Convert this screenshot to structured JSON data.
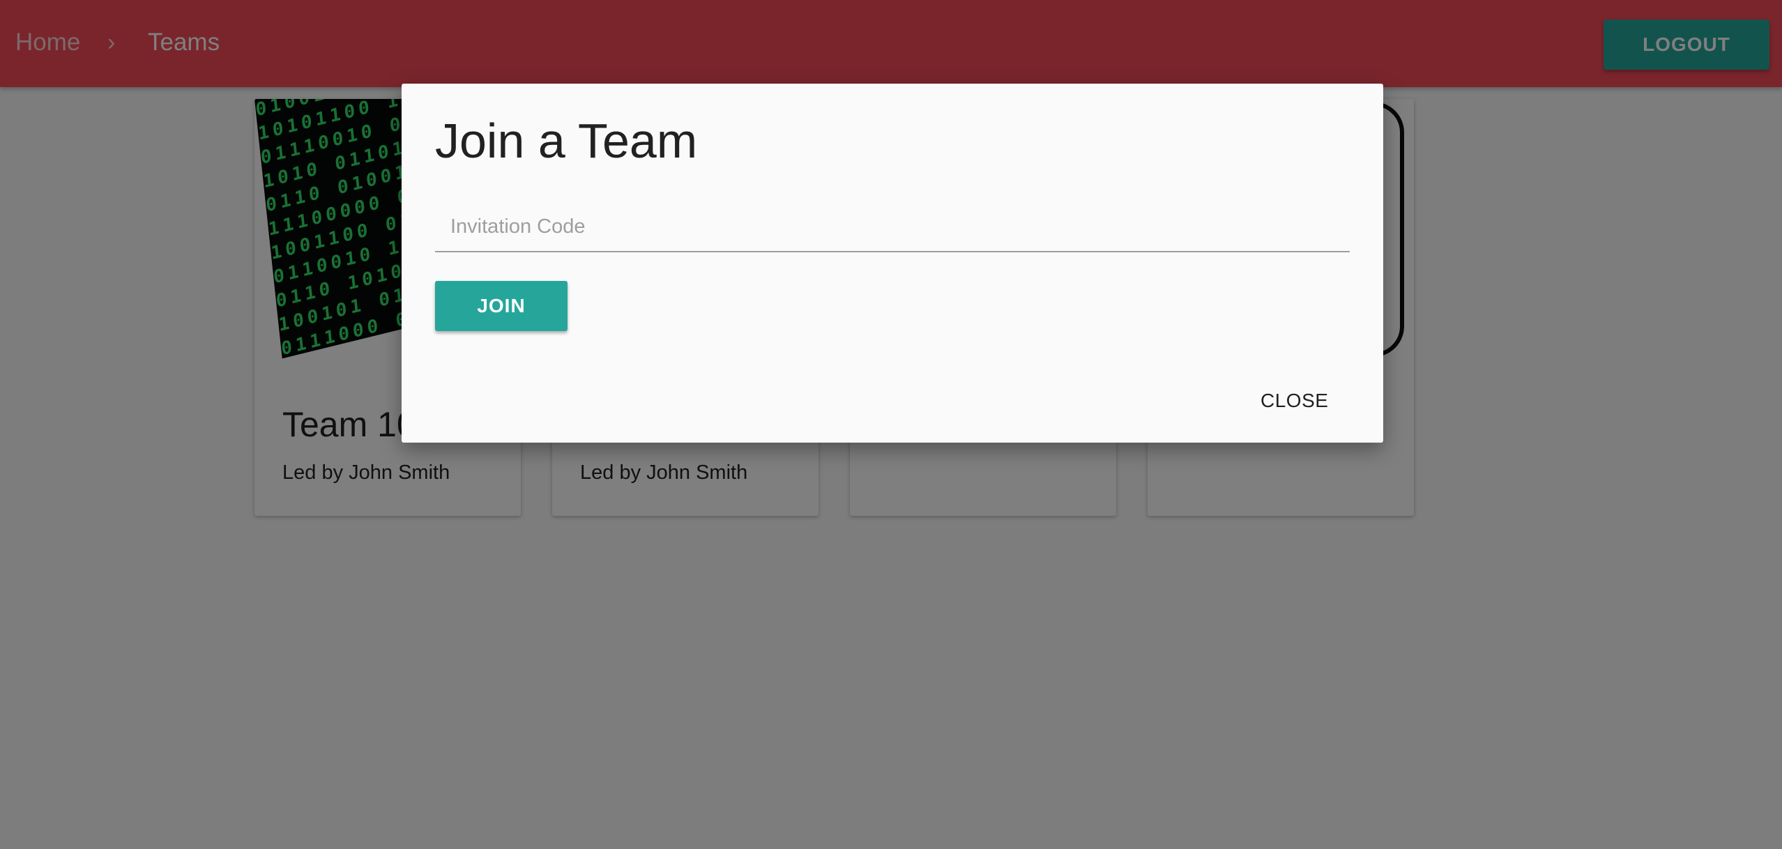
{
  "appbar": {
    "breadcrumb": [
      "Home",
      "Teams"
    ],
    "separator": "›",
    "logout_label": "LOGOUT",
    "color": "#f44a58"
  },
  "cards": [
    {
      "title": "Team 10",
      "subtitle": "Led by John Smith",
      "media": "binary-code-image"
    },
    {
      "title": "",
      "subtitle": "Led by John Smith",
      "media": "none"
    },
    {
      "title": "",
      "subtitle": "",
      "media": "none"
    },
    {
      "title": "",
      "subtitle": "",
      "media": "add-box"
    }
  ],
  "dialog": {
    "title": "Join a Team",
    "input_placeholder": "Invitation Code",
    "input_value": "",
    "join_label": "JOIN",
    "close_label": "CLOSE"
  },
  "colors": {
    "accent": "#26a69a",
    "appbar": "#f44a58",
    "scrim": "rgba(0,0,0,0.5)"
  }
}
